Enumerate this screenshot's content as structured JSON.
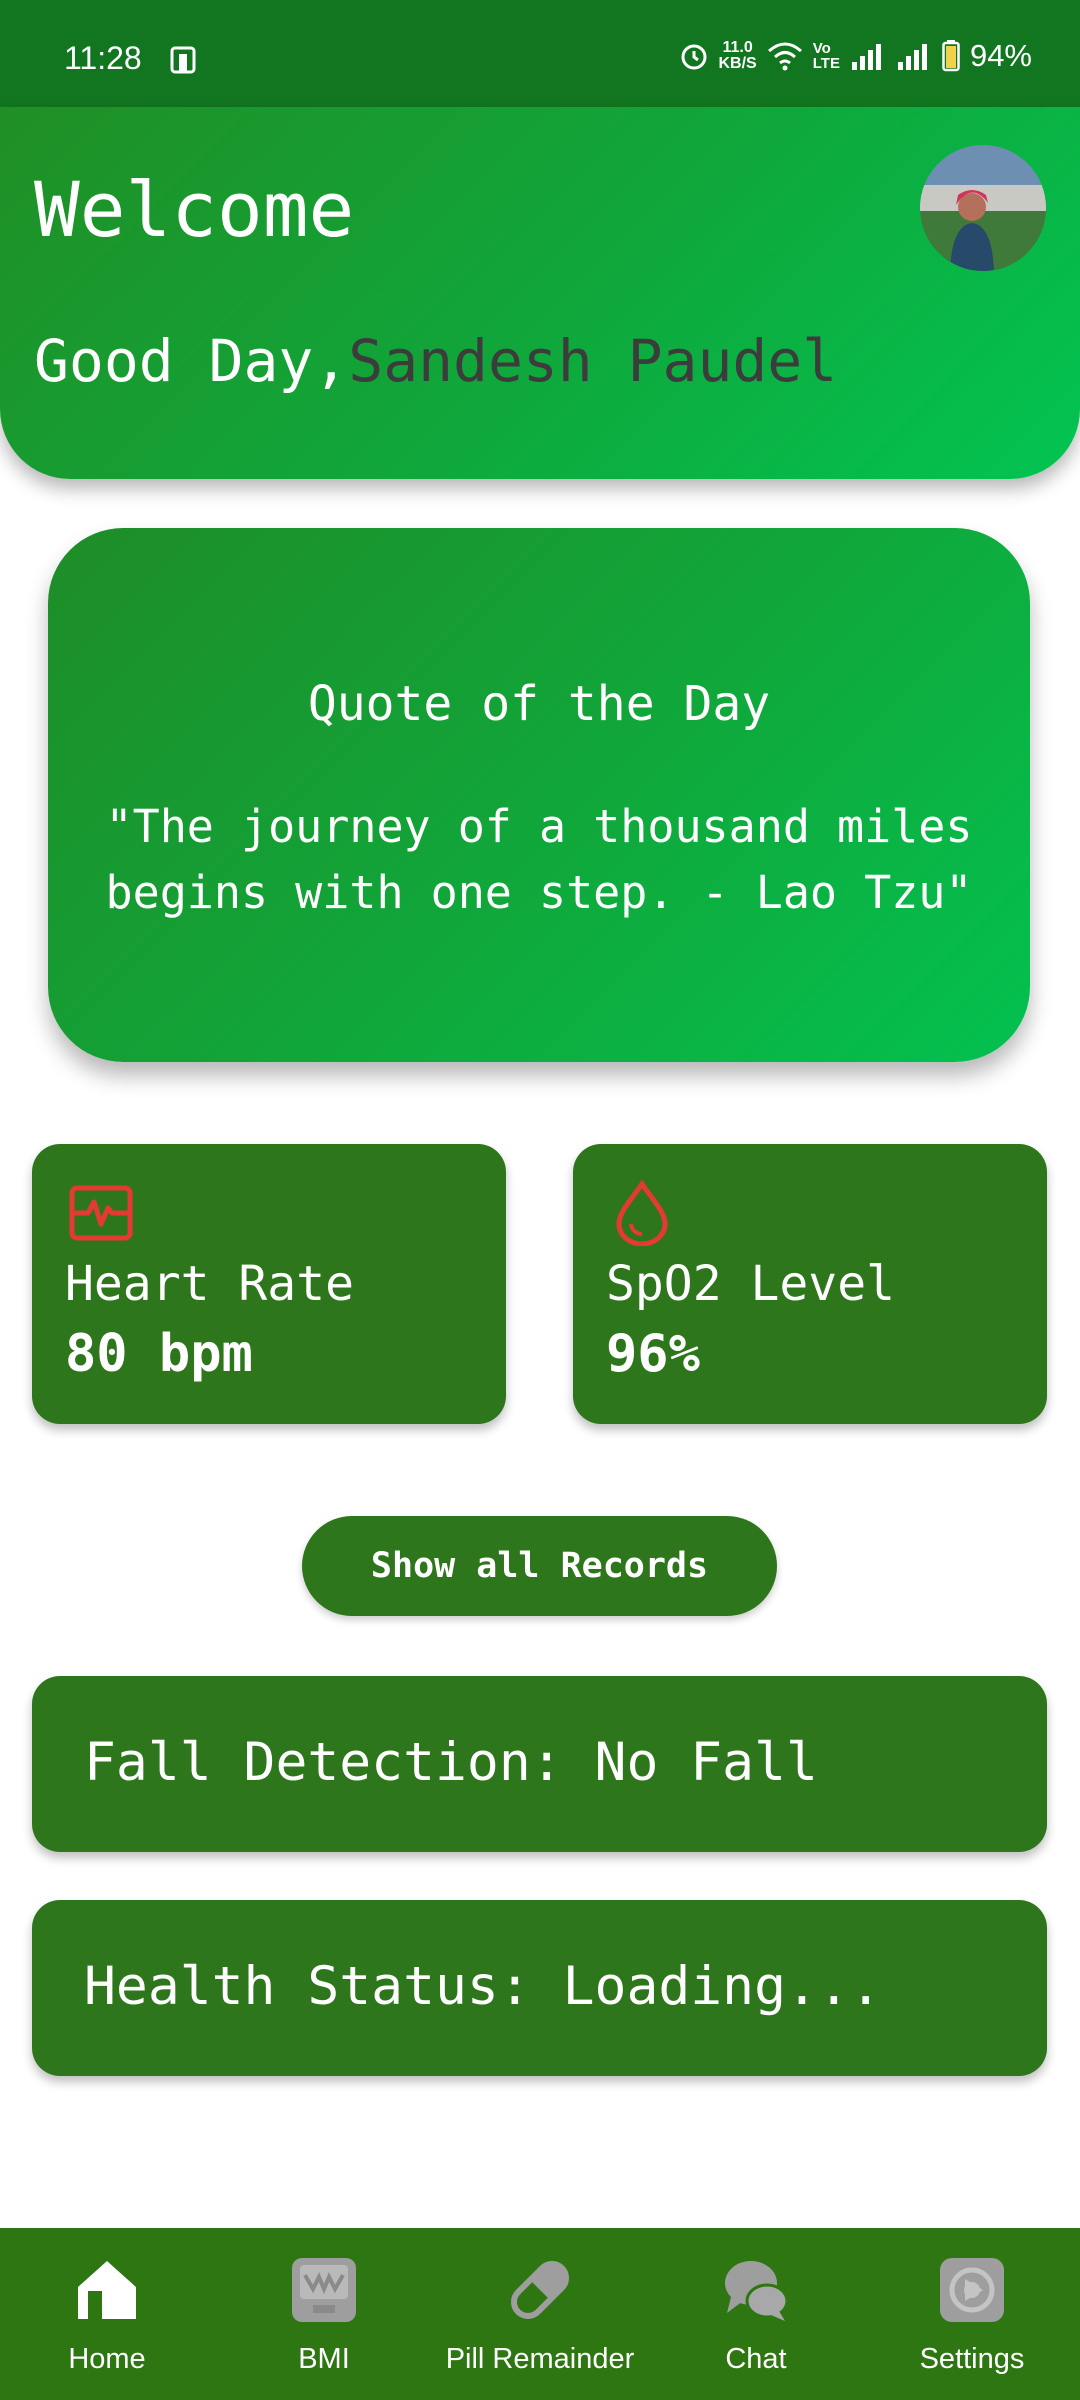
{
  "status_bar": {
    "time": "11:28",
    "net_speed_value": "11.0",
    "net_speed_unit": "KB/S",
    "volte_top": "Vo",
    "volte_bottom": "LTE",
    "battery": "94%"
  },
  "header": {
    "title": "Welcome",
    "greeting": "Good Day,",
    "user_name": "Sandesh Paudel"
  },
  "quote": {
    "title": "Quote of the Day",
    "text": "\"The journey of a thousand miles begins with one step. - Lao Tzu\""
  },
  "vitals": {
    "heart_rate": {
      "label": "Heart Rate",
      "value": "80 bpm",
      "icon": "heart-rate-monitor-icon"
    },
    "spo2": {
      "label": "SpO2 Level",
      "value": "96%",
      "icon": "blood-drop-icon"
    }
  },
  "actions": {
    "show_records_label": "Show all Records"
  },
  "panels": {
    "fall_detection": "Fall Detection: No Fall",
    "health_status": "Health Status: Loading..."
  },
  "bottom_nav": [
    {
      "label": "Home",
      "icon": "home-icon",
      "active": true
    },
    {
      "label": "BMI",
      "icon": "scale-icon",
      "active": false
    },
    {
      "label": "Pill Remainder",
      "icon": "pill-icon",
      "active": false
    },
    {
      "label": "Chat",
      "icon": "chat-icon",
      "active": false
    },
    {
      "label": "Settings",
      "icon": "settings-icon",
      "active": false
    }
  ],
  "colors": {
    "header_green": "#0fa83c",
    "card_green": "#2e761c",
    "icon_red": "#e53935",
    "name_gray": "#3c3c3c"
  }
}
